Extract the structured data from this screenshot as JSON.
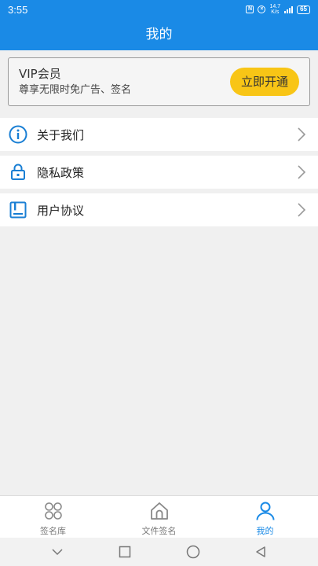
{
  "status_bar": {
    "time": "3:55",
    "net_speed": "14.7\nK/s",
    "battery": "65"
  },
  "header": {
    "title": "我的"
  },
  "vip": {
    "title": "VIP会员",
    "subtitle": "尊享无限时免广告、签名",
    "button_label": "立即开通"
  },
  "menu": [
    {
      "label": "关于我们",
      "icon": "info-icon"
    },
    {
      "label": "隐私政策",
      "icon": "lock-icon"
    },
    {
      "label": "用户协议",
      "icon": "document-icon"
    }
  ],
  "bottom_nav": [
    {
      "label": "签名库",
      "icon": "grid-icon",
      "active": false
    },
    {
      "label": "文件签名",
      "icon": "home-icon",
      "active": false
    },
    {
      "label": "我的",
      "icon": "person-icon",
      "active": true
    }
  ],
  "colors": {
    "primary": "#1a8ae6",
    "vip_button": "#f8c516",
    "icon_blue": "#1a7fd4"
  }
}
